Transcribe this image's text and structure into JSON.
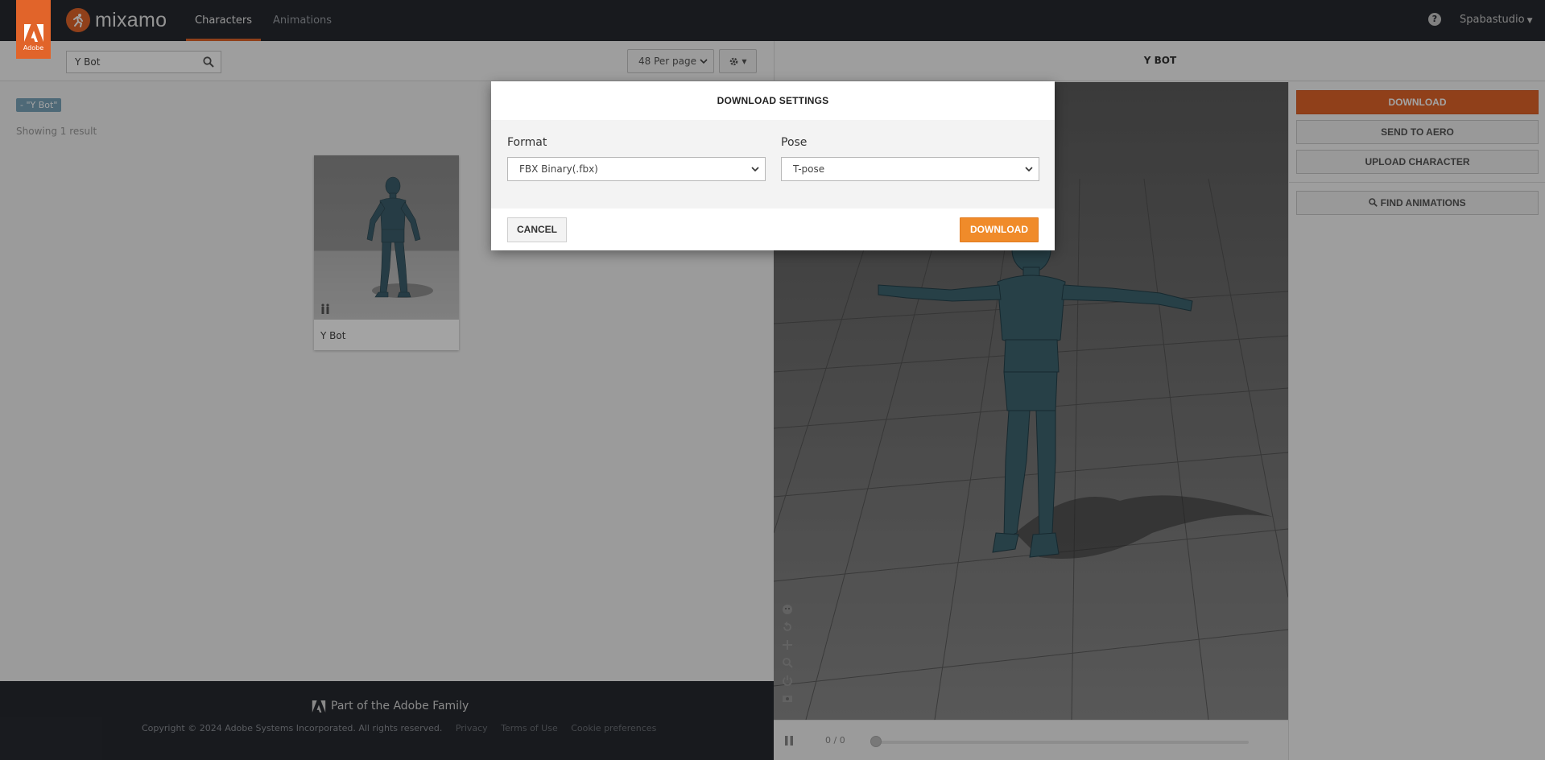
{
  "brand": {
    "adobe_badge_text": "Adobe",
    "app_name": "mixamo",
    "accent_color": "#e1642a"
  },
  "nav": {
    "tabs": [
      {
        "label": "Characters",
        "active": true
      },
      {
        "label": "Animations",
        "active": false
      }
    ],
    "help_icon": "question-circle-icon",
    "user_name": "Spabastudio"
  },
  "toolbar": {
    "search_value": "Y Bot",
    "per_page": "48 Per page",
    "settings_icon": "gear-icon"
  },
  "results": {
    "filter_chip": "- \"Y Bot\"",
    "count_text": "Showing 1 result",
    "items": [
      {
        "name": "Y Bot"
      }
    ]
  },
  "footer": {
    "family_text": "Part of the Adobe Family",
    "copyright": "Copyright © 2024 Adobe Systems Incorporated. All rights reserved.",
    "links": [
      "Privacy",
      "Terms of Use",
      "Cookie preferences"
    ]
  },
  "viewer": {
    "character_title": "Y BOT",
    "frame_counter": "0 / 0",
    "tools": [
      "face-icon",
      "reset-icon",
      "pan-icon",
      "zoom-icon",
      "power-icon",
      "camera-icon"
    ]
  },
  "actions": {
    "download": "DOWNLOAD",
    "send_to_aero": "SEND TO AERO",
    "upload_character": "UPLOAD CHARACTER",
    "find_animations": "FIND ANIMATIONS"
  },
  "modal": {
    "title": "DOWNLOAD SETTINGS",
    "format_label": "Format",
    "format_value": "FBX Binary(.fbx)",
    "pose_label": "Pose",
    "pose_value": "T-pose",
    "cancel_label": "CANCEL",
    "download_label": "DOWNLOAD"
  }
}
